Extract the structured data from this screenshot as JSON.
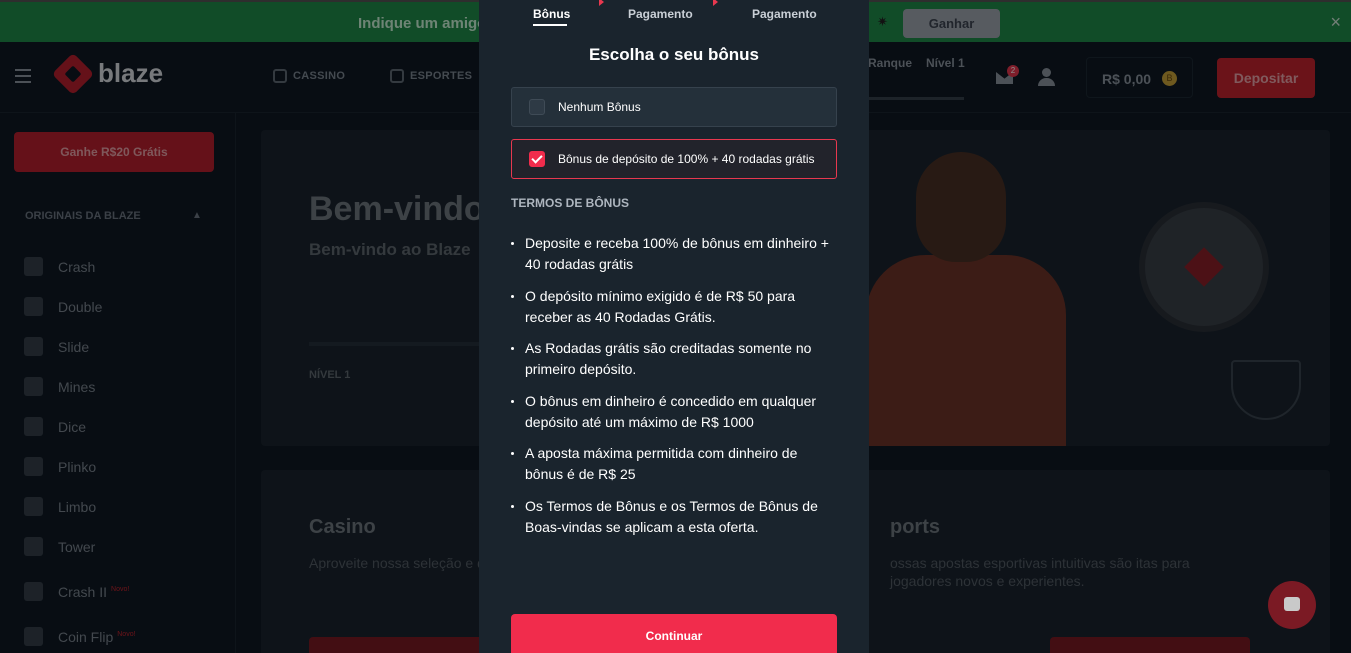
{
  "promo": {
    "text": "Indique um amigo:",
    "button_label": "Ganhar",
    "close": "×"
  },
  "header": {
    "logo_text": "blaze",
    "nav": [
      {
        "label": "CASSINO",
        "icon": "casino-icon"
      },
      {
        "label": "ESPORTES",
        "icon": "sports-icon"
      }
    ],
    "right_labels": [
      "Ranque",
      "Nível 1"
    ],
    "mail_badge": "2",
    "balance": "R$ 0,00",
    "coin_symbol": "B",
    "deposit_label": "Depositar"
  },
  "sidebar": {
    "earn_label": "Ganhe R$20 Grátis",
    "section_title": "ORIGINAIS DA BLAZE",
    "items": [
      {
        "label": "Crash",
        "icon": "crash-icon",
        "tag": ""
      },
      {
        "label": "Double",
        "icon": "double-icon",
        "tag": ""
      },
      {
        "label": "Slide",
        "icon": "slide-icon",
        "tag": ""
      },
      {
        "label": "Mines",
        "icon": "mines-icon",
        "tag": ""
      },
      {
        "label": "Dice",
        "icon": "dice-icon",
        "tag": ""
      },
      {
        "label": "Plinko",
        "icon": "plinko-icon",
        "tag": ""
      },
      {
        "label": "Limbo",
        "icon": "limbo-icon",
        "tag": ""
      },
      {
        "label": "Tower",
        "icon": "tower-icon",
        "tag": ""
      },
      {
        "label": "Crash II",
        "icon": "crash-ii-icon",
        "tag": "Novo!"
      },
      {
        "label": "Coin Flip",
        "icon": "coin-flip-icon",
        "tag": "Novo!"
      }
    ]
  },
  "hero": {
    "title": "Bem-vindo",
    "subtitle": "Bem-vindo ao Blaze",
    "level": "NÍVEL 1"
  },
  "cards": [
    {
      "title": "Casino",
      "desc": "Aproveite nossa seleção e dealers ao vivo e jogos ori"
    },
    {
      "title": "ports",
      "desc": "ossas apostas esportivas intuitivas são itas para jogadores novos e experientes."
    }
  ],
  "modal": {
    "steps": [
      {
        "label": "Bônus",
        "active": true
      },
      {
        "label": "Pagamento",
        "active": false
      },
      {
        "label": "Pagamento",
        "active": false
      }
    ],
    "title": "Escolha o seu bônus",
    "options": [
      {
        "label": "Nenhum Bônus",
        "checked": false
      },
      {
        "label": "Bônus de depósito de 100% + 40 rodadas grátis",
        "checked": true
      }
    ],
    "terms_heading": "TERMOS DE BÔNUS",
    "terms": [
      "Deposite e receba 100% de bônus em dinheiro + 40 rodadas grátis",
      "O depósito mínimo exigido é de R$ 50 para receber as 40 Rodadas Grátis.",
      "As Rodadas grátis são creditadas somente no primeiro depósito.",
      "O bônus em dinheiro é concedido em qualquer depósito até um máximo de R$ 1000",
      "A aposta máxima permitida com dinheiro de bônus é de R$ 25",
      "Os Termos de Bônus e os Termos de Bônus de Boas-vindas se aplicam a esta oferta."
    ],
    "continue_label": "Continuar"
  },
  "colors": {
    "accent": "#f12c4c",
    "promo_green": "#1f8a4a",
    "background": "#0f1923",
    "modal_bg": "#1a242d"
  }
}
